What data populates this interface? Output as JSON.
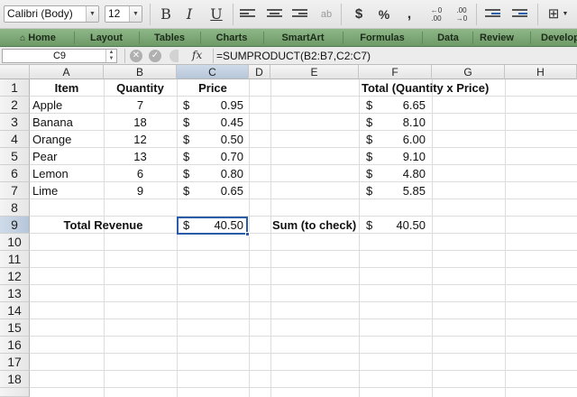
{
  "toolbar": {
    "font_name": "Calibri (Body)",
    "font_size": "12",
    "bold_label": "B",
    "italic_label": "I",
    "underline_label": "U",
    "currency_label": "$",
    "percent_label": "%",
    "comma_label": ",",
    "icons": [
      "align-left-icon",
      "align-center-icon",
      "align-right-icon",
      "text-orientation-icon",
      "increase-decimal-icon",
      "decrease-decimal-icon",
      "decrease-indent-icon",
      "increase-indent-icon",
      "borders-icon"
    ]
  },
  "ribbon": {
    "tabs": [
      "Home",
      "Layout",
      "Tables",
      "Charts",
      "SmartArt",
      "Formulas",
      "Data",
      "Review",
      "Develop"
    ],
    "accent": "#7fa978"
  },
  "formula_bar": {
    "cell_ref": "C9",
    "formula": "=SUMPRODUCT(B2:B7,C2:C7)",
    "fx_label": "fx"
  },
  "sheet": {
    "columns": [
      "A",
      "B",
      "C",
      "D",
      "E",
      "F",
      "G",
      "H"
    ],
    "rows": [
      "1",
      "2",
      "3",
      "4",
      "5",
      "6",
      "7",
      "8",
      "9",
      "10",
      "11",
      "12",
      "13",
      "14",
      "15",
      "16",
      "17",
      "18"
    ],
    "selected_cell": "C9",
    "header": {
      "item": "Item",
      "quantity": "Quantity",
      "price": "Price",
      "total": "Total (Quantity x Price)"
    },
    "data": [
      {
        "item": "Apple",
        "quantity": "7",
        "currency": "$",
        "price": "0.95",
        "total_currency": "$",
        "total": "6.65"
      },
      {
        "item": "Banana",
        "quantity": "18",
        "currency": "$",
        "price": "0.45",
        "total_currency": "$",
        "total": "8.10"
      },
      {
        "item": "Orange",
        "quantity": "12",
        "currency": "$",
        "price": "0.50",
        "total_currency": "$",
        "total": "6.00"
      },
      {
        "item": "Pear",
        "quantity": "13",
        "currency": "$",
        "price": "0.70",
        "total_currency": "$",
        "total": "9.10"
      },
      {
        "item": "Lemon",
        "quantity": "6",
        "currency": "$",
        "price": "0.80",
        "total_currency": "$",
        "total": "4.80"
      },
      {
        "item": "Lime",
        "quantity": "9",
        "currency": "$",
        "price": "0.65",
        "total_currency": "$",
        "total": "5.85"
      }
    ],
    "total_revenue": {
      "label": "Total Revenue",
      "currency": "$",
      "value": "40.50",
      "check_label": "Sum (to check)",
      "check_currency": "$",
      "check_value": "40.50"
    }
  }
}
